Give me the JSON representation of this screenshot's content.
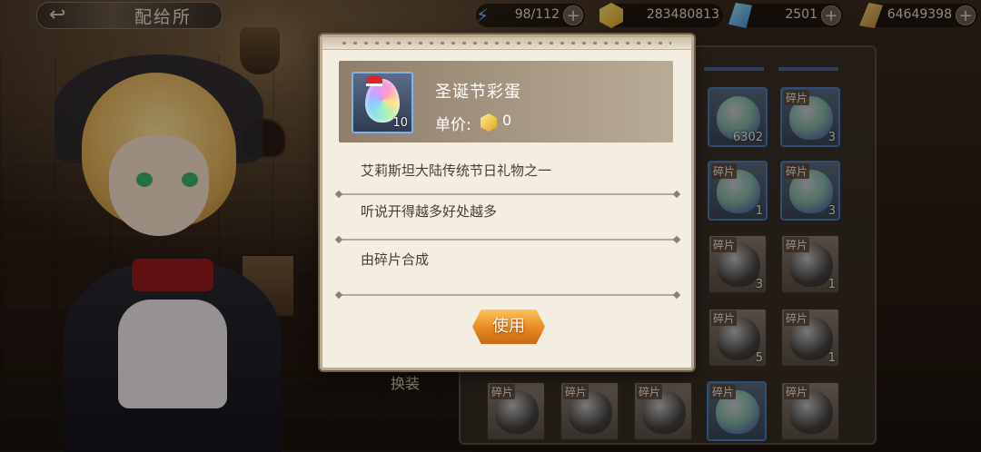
{
  "header": {
    "title": "配给所",
    "resources": [
      {
        "icon": "energy-icon",
        "value": "98/112"
      },
      {
        "icon": "gold-icon",
        "value": "283480813"
      },
      {
        "icon": "gem-icon",
        "value": "2501"
      },
      {
        "icon": "coin-icon",
        "value": "64649398"
      }
    ]
  },
  "inventory": {
    "change_label": "换装",
    "fragment_label": "碎片",
    "slots": [
      {
        "fragment": false,
        "count": "6302"
      },
      {
        "fragment": true,
        "count": "3"
      },
      {
        "fragment": true,
        "count": ""
      },
      {
        "fragment": true,
        "count": "1"
      },
      {
        "fragment": true,
        "count": "3"
      },
      {
        "fragment": true,
        "count": "3"
      },
      {
        "fragment": true,
        "count": "1"
      },
      {
        "fragment": true,
        "count": "5"
      },
      {
        "fragment": true,
        "count": "1"
      }
    ]
  },
  "modal": {
    "item_name": "圣诞节彩蛋",
    "item_quantity": "10",
    "price_label": "单价:",
    "price_value": "0",
    "descriptions": [
      "艾莉斯坦大陆传统节日礼物之一",
      "听说开得越多好处越多",
      "由碎片合成"
    ],
    "use_button": "使用"
  }
}
